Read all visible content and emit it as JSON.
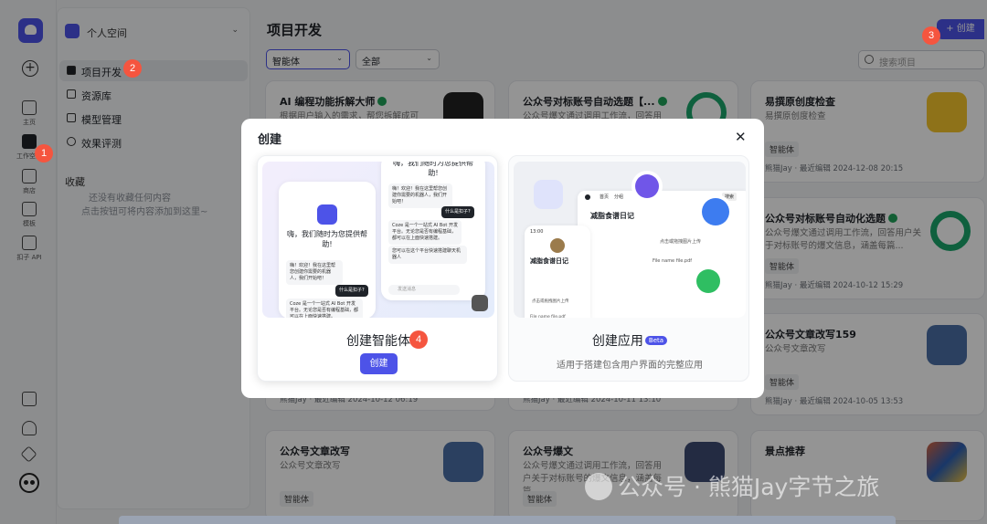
{
  "rail": {
    "items": [
      {
        "label": "主页"
      },
      {
        "label": "工作空间"
      },
      {
        "label": "商店"
      },
      {
        "label": "模板"
      },
      {
        "label": "扣子 API"
      }
    ]
  },
  "workspace": {
    "name": "个人空间",
    "nav": [
      "项目开发",
      "资源库",
      "模型管理",
      "效果评测"
    ],
    "favorites_title": "收藏",
    "favorites_empty_1": "还没有收藏任何内容",
    "favorites_empty_2": "点击按钮可将内容添加到这里~"
  },
  "main": {
    "title": "项目开发",
    "create_label": "+ 创建",
    "filter_type": "智能体",
    "filter_scope": "全部",
    "search_placeholder": "搜索项目"
  },
  "cards": [
    {
      "title": "AI 编程功能拆解大师",
      "desc": "根据用户输入的需求，帮您拆解成可以",
      "tag": "",
      "meta": "",
      "verified": true,
      "thumb": "#222222"
    },
    {
      "title": "公众号对标账号自动选题【...",
      "desc": "公众号爆文通过调用工作流，回答用户",
      "tag": "",
      "meta": "",
      "verified": true,
      "thumb": "#1ba56c"
    },
    {
      "title": "易撰原创度检查",
      "desc": "易撰原创度检查",
      "tag": "智能体",
      "meta": "熊猫Jay · 最近编辑 2024-12-08 20:15",
      "verified": false,
      "thumb": "#f5c42c"
    },
    {
      "title": "公众号对标账号自动化选题",
      "desc": "公众号爆文通过调用工作流，回答用户关于对标账号的爆文信息，涵盖每篇...",
      "tag": "智能体",
      "meta": "熊猫Jay · 最近编辑 2024-10-12 15:29",
      "verified": true,
      "thumb": "#1ba56c"
    },
    {
      "title": "公众号文章改写159",
      "desc": "公众号文章改写",
      "tag": "智能体",
      "meta": "熊猫Jay · 最近编辑 2024-10-05 13:53",
      "verified": false,
      "thumb": "#4a6fa5"
    },
    {
      "title": "公众号文章改写",
      "desc": "公众号文章改写",
      "tag": "智能体",
      "meta": "",
      "verified": false,
      "thumb": "#4a6fa5"
    },
    {
      "title": "公众号爆文",
      "desc": "公众号爆文通过调用工作流，回答用户关于对标账号的爆文信息，涵盖每篇...",
      "tag": "智能体",
      "meta": "",
      "verified": false,
      "thumb": "#3d4a73"
    },
    {
      "title": "景点推荐",
      "desc": "",
      "tag": "",
      "meta": "",
      "verified": false,
      "thumb": "#d9633b"
    }
  ],
  "behind_meta": {
    "left": "熊猫Jay · 最近编辑 2024-10-12 06:19",
    "mid": "熊猫Jay · 最近编辑 2024-10-11 13:10"
  },
  "modal": {
    "title": "创建",
    "close": "✕",
    "agent": {
      "name": "创建智能体",
      "button": "创建",
      "chat_greeting": "嗨，我们随时为您提供帮助!",
      "chat_intro": "嗨！欢迎！我在这里帮您创建你需要的机器人，我们开始吧！",
      "chat_prompt": "什么是扣子?",
      "chat_answer": "Coze 是一个一站式 AI Bot 开发平台。无论您是否有编程基础，都可以在上面快速搭建。",
      "chat_reply": "您可以在这个平台快速搭建聊天机器人",
      "chat_input": "发送消息"
    },
    "app": {
      "name": "创建应用",
      "beta": "Beta",
      "sub": "适用于搭建包含用户界面的完整应用",
      "screen_title": "减脂食谱日记",
      "phone_time": "13:00",
      "file_label": "File name file.pdf",
      "upload_label": "点击或拖拽图片上传",
      "tab_home": "首页",
      "tab_store": "分组",
      "tab_btn": "搜索"
    }
  },
  "badges": [
    "1",
    "2",
    "3",
    "4"
  ],
  "watermark": "公众号 · 熊猫Jay字节之旅",
  "colors": {
    "accent": "#4d53e8",
    "badge": "#f5553f",
    "verified": "#20a35a"
  }
}
